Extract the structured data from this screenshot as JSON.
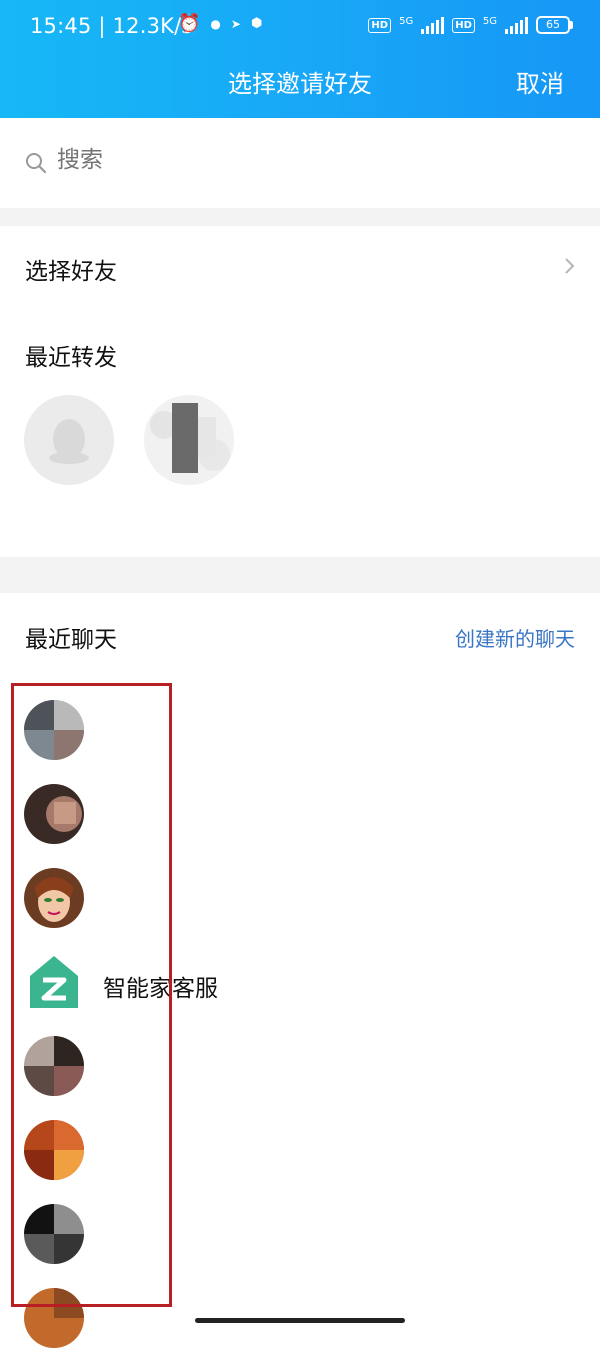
{
  "status_bar": {
    "time": "15:45",
    "speed": "| 12.3K/s",
    "net1": "5G",
    "net2": "5G",
    "hd_label": "HD",
    "battery": "65"
  },
  "header": {
    "title": "选择邀请好友",
    "cancel_label": "取消"
  },
  "search": {
    "placeholder": "搜索"
  },
  "select_friends": {
    "label": "选择好友"
  },
  "recent_forward": {
    "title": "最近转发",
    "items": [
      {
        "name": ""
      },
      {
        "name": ""
      }
    ]
  },
  "recent_chats": {
    "title": "最近聊天",
    "new_chat_label": "创建新的聊天",
    "items": [
      {
        "name": ""
      },
      {
        "name": ""
      },
      {
        "name": ""
      },
      {
        "name": "智能家客服"
      },
      {
        "name": ""
      },
      {
        "name": ""
      },
      {
        "name": ""
      },
      {
        "name": ""
      }
    ]
  },
  "colors": {
    "header_gradient_start": "#16b8f6",
    "header_gradient_end": "#1597f6",
    "link_blue": "#3a76c4",
    "highlight_red": "#b71f24",
    "section_gap": "#f3f3f3"
  }
}
